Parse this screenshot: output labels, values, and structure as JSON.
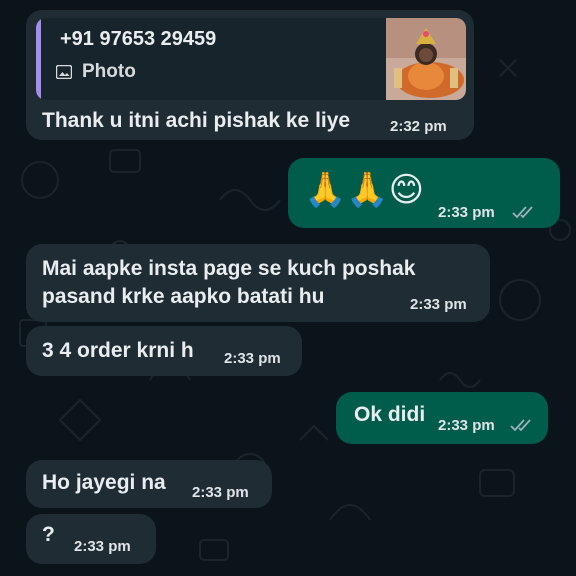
{
  "chat": {
    "messages": [
      {
        "direction": "incoming",
        "reply_to": {
          "sender": "+91 97653 29459",
          "type_label": "Photo",
          "icon": "photo-icon"
        },
        "text": "Thank u itni achi pishak ke liye",
        "time": "2:32 pm"
      },
      {
        "direction": "outgoing",
        "text": "🙏🙏😊",
        "time": "2:33 pm",
        "status": "read"
      },
      {
        "direction": "incoming",
        "text_lines": [
          "Mai aapke insta page se kuch poshak",
          "pasand krke aapko batati hu"
        ],
        "time": "2:33 pm"
      },
      {
        "direction": "incoming",
        "text": "3 4 order krni h",
        "time": "2:33 pm"
      },
      {
        "direction": "outgoing",
        "text": "Ok didi",
        "time": "2:33 pm",
        "status": "read"
      },
      {
        "direction": "incoming",
        "text": "Ho jayegi na",
        "time": "2:33 pm"
      },
      {
        "direction": "incoming",
        "text": "?",
        "time": "2:33 pm"
      }
    ]
  },
  "colors": {
    "background": "#0b141a",
    "incoming_bubble": "#1f2c34",
    "outgoing_bubble": "#005c4b",
    "quote_accent": "#a58df0",
    "read_ticks": "#9fb2bb"
  }
}
